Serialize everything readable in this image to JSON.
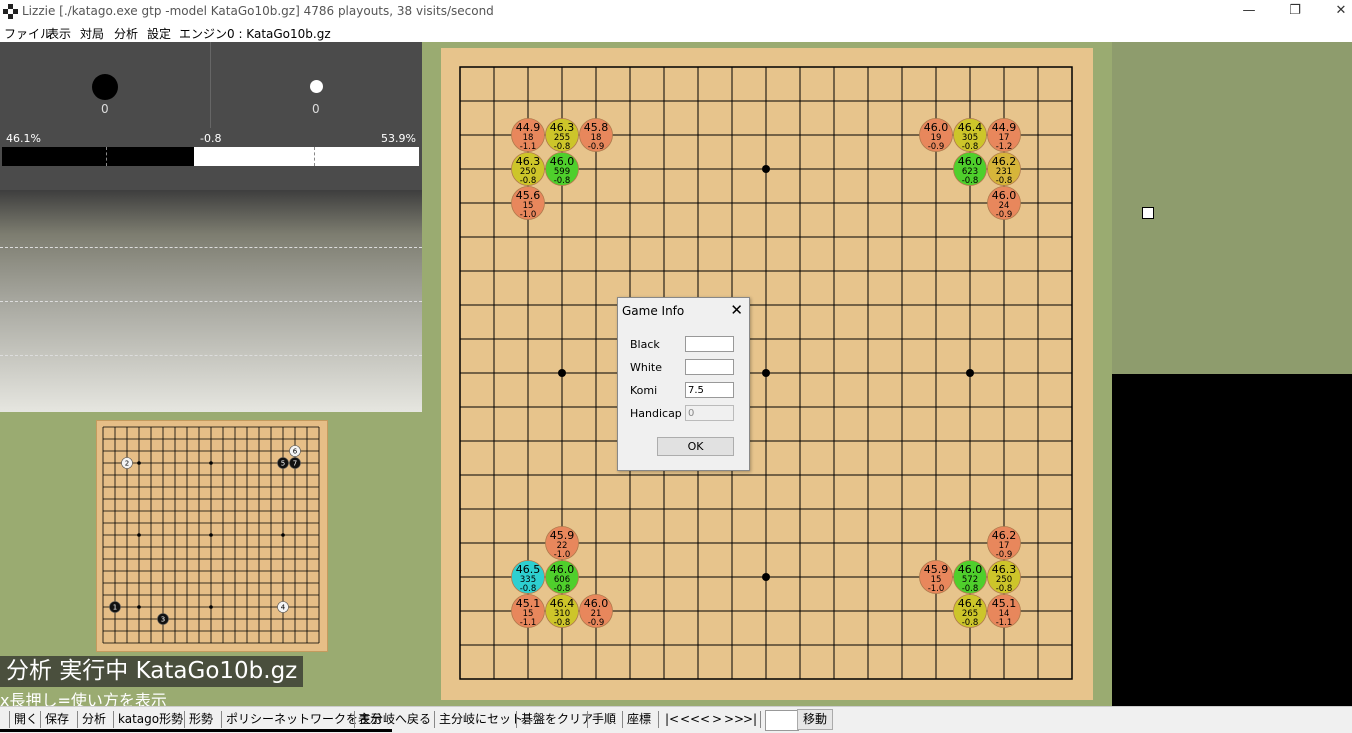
{
  "window": {
    "title": "Lizzie [./katago.exe gtp -model KataGo10b.gz] 4786 playouts, 38 visits/second",
    "minimize_label": "—",
    "maximize_label": "❐",
    "close_label": "✕"
  },
  "menu": [
    {
      "label": "ファイル"
    },
    {
      "label": "表示"
    },
    {
      "label": "対局"
    },
    {
      "label": "分析"
    },
    {
      "label": "設定"
    },
    {
      "label": "エンジン0 : KataGo10b.gz"
    }
  ],
  "captures": {
    "black": "0",
    "white": "0"
  },
  "winrate": {
    "black_label": "46.1%",
    "score_label": "-0.8",
    "white_label": "53.9%",
    "black_fraction": 0.461
  },
  "status": {
    "analysis_text": "分析 実行中 KataGo10b.gz",
    "hint_text": "x長押し=使い方を表示"
  },
  "board": {
    "size": 19,
    "star_points": [
      [
        3,
        3
      ],
      [
        3,
        9
      ],
      [
        3,
        15
      ],
      [
        9,
        3
      ],
      [
        9,
        9
      ],
      [
        9,
        15
      ],
      [
        15,
        3
      ],
      [
        15,
        9
      ],
      [
        15,
        15
      ]
    ],
    "suggestions": [
      {
        "col": 2,
        "row": 2,
        "winrate": "44.9",
        "visits": "18",
        "score": "-1.1",
        "color": "#e8875c"
      },
      {
        "col": 3,
        "row": 2,
        "winrate": "46.3",
        "visits": "255",
        "score": "-0.8",
        "color": "#cdc52a"
      },
      {
        "col": 4,
        "row": 2,
        "winrate": "45.8",
        "visits": "18",
        "score": "-0.9",
        "color": "#e8875c"
      },
      {
        "col": 2,
        "row": 3,
        "winrate": "46.3",
        "visits": "250",
        "score": "-0.8",
        "color": "#cdc52a"
      },
      {
        "col": 3,
        "row": 3,
        "winrate": "46.0",
        "visits": "599",
        "score": "-0.8",
        "color": "#4fcf2c"
      },
      {
        "col": 2,
        "row": 4,
        "winrate": "45.6",
        "visits": "15",
        "score": "-1.0",
        "color": "#e8875c"
      },
      {
        "col": 14,
        "row": 2,
        "winrate": "46.0",
        "visits": "19",
        "score": "-0.9",
        "color": "#e8875c"
      },
      {
        "col": 15,
        "row": 2,
        "winrate": "46.4",
        "visits": "305",
        "score": "-0.8",
        "color": "#cdc52a"
      },
      {
        "col": 16,
        "row": 2,
        "winrate": "44.9",
        "visits": "17",
        "score": "-1.2",
        "color": "#e8875c"
      },
      {
        "col": 15,
        "row": 3,
        "winrate": "46.0",
        "visits": "623",
        "score": "-0.8",
        "color": "#4fcf2c"
      },
      {
        "col": 16,
        "row": 3,
        "winrate": "46.2",
        "visits": "231",
        "score": "-0.8",
        "color": "#d6b53a"
      },
      {
        "col": 16,
        "row": 4,
        "winrate": "46.0",
        "visits": "24",
        "score": "-0.9",
        "color": "#e8875c"
      },
      {
        "col": 3,
        "row": 14,
        "winrate": "45.9",
        "visits": "22",
        "score": "-1.0",
        "color": "#e8875c"
      },
      {
        "col": 2,
        "row": 15,
        "winrate": "46.5",
        "visits": "335",
        "score": "-0.8",
        "color": "#2ecfd0"
      },
      {
        "col": 3,
        "row": 15,
        "winrate": "46.0",
        "visits": "606",
        "score": "-0.8",
        "color": "#4fcf2c"
      },
      {
        "col": 2,
        "row": 16,
        "winrate": "45.1",
        "visits": "15",
        "score": "-1.1",
        "color": "#e8875c"
      },
      {
        "col": 3,
        "row": 16,
        "winrate": "46.4",
        "visits": "310",
        "score": "-0.8",
        "color": "#cdc52a"
      },
      {
        "col": 4,
        "row": 16,
        "winrate": "46.0",
        "visits": "21",
        "score": "-0.9",
        "color": "#e8875c"
      },
      {
        "col": 16,
        "row": 14,
        "winrate": "46.2",
        "visits": "17",
        "score": "-0.9",
        "color": "#e8875c"
      },
      {
        "col": 14,
        "row": 15,
        "winrate": "45.9",
        "visits": "15",
        "score": "-1.0",
        "color": "#e8875c"
      },
      {
        "col": 15,
        "row": 15,
        "winrate": "46.0",
        "visits": "572",
        "score": "-0.8",
        "color": "#4fcf2c"
      },
      {
        "col": 16,
        "row": 15,
        "winrate": "46.3",
        "visits": "250",
        "score": "-0.8",
        "color": "#cdc52a"
      },
      {
        "col": 15,
        "row": 16,
        "winrate": "46.4",
        "visits": "265",
        "score": "-0.8",
        "color": "#cdc52a"
      },
      {
        "col": 16,
        "row": 16,
        "winrate": "45.1",
        "visits": "14",
        "score": "-1.1",
        "color": "#e8875c"
      }
    ]
  },
  "mini_board": {
    "stones": [
      {
        "col": 1,
        "row": 15,
        "color": "black",
        "num": "1"
      },
      {
        "col": 2,
        "row": 3,
        "color": "white",
        "num": "2"
      },
      {
        "col": 5,
        "row": 16,
        "color": "black",
        "num": "3"
      },
      {
        "col": 15,
        "row": 15,
        "color": "white",
        "num": "4"
      },
      {
        "col": 15,
        "row": 3,
        "color": "black",
        "num": "5"
      },
      {
        "col": 16,
        "row": 2,
        "color": "white",
        "num": "6"
      },
      {
        "col": 16,
        "row": 3,
        "color": "black",
        "num": "7"
      }
    ]
  },
  "dialog": {
    "title": "Game Info",
    "close_label": "✕",
    "black_label": "Black",
    "black_value": "",
    "white_label": "White",
    "white_value": "",
    "komi_label": "Komi",
    "komi_value": "7.5",
    "handicap_label": "Handicap",
    "handicap_value": "0",
    "ok_label": "OK"
  },
  "toolbar": [
    {
      "label": "開く"
    },
    {
      "label": "保存"
    },
    {
      "label": "分析"
    },
    {
      "label": "katago形勢"
    },
    {
      "label": "形勢"
    },
    {
      "label": "ポリシーネットワークを表示"
    },
    {
      "label": "主分岐へ戻る"
    },
    {
      "label": "主分岐にセット"
    },
    {
      "label": "碁盤をクリア"
    },
    {
      "label": "手順"
    },
    {
      "label": "座標"
    },
    {
      "label": "|<"
    },
    {
      "label": "<<"
    },
    {
      "label": "<"
    },
    {
      "label": ">"
    },
    {
      "label": ">>"
    },
    {
      "label": ">|"
    }
  ],
  "move_button_label": "移動",
  "move_input_value": ""
}
